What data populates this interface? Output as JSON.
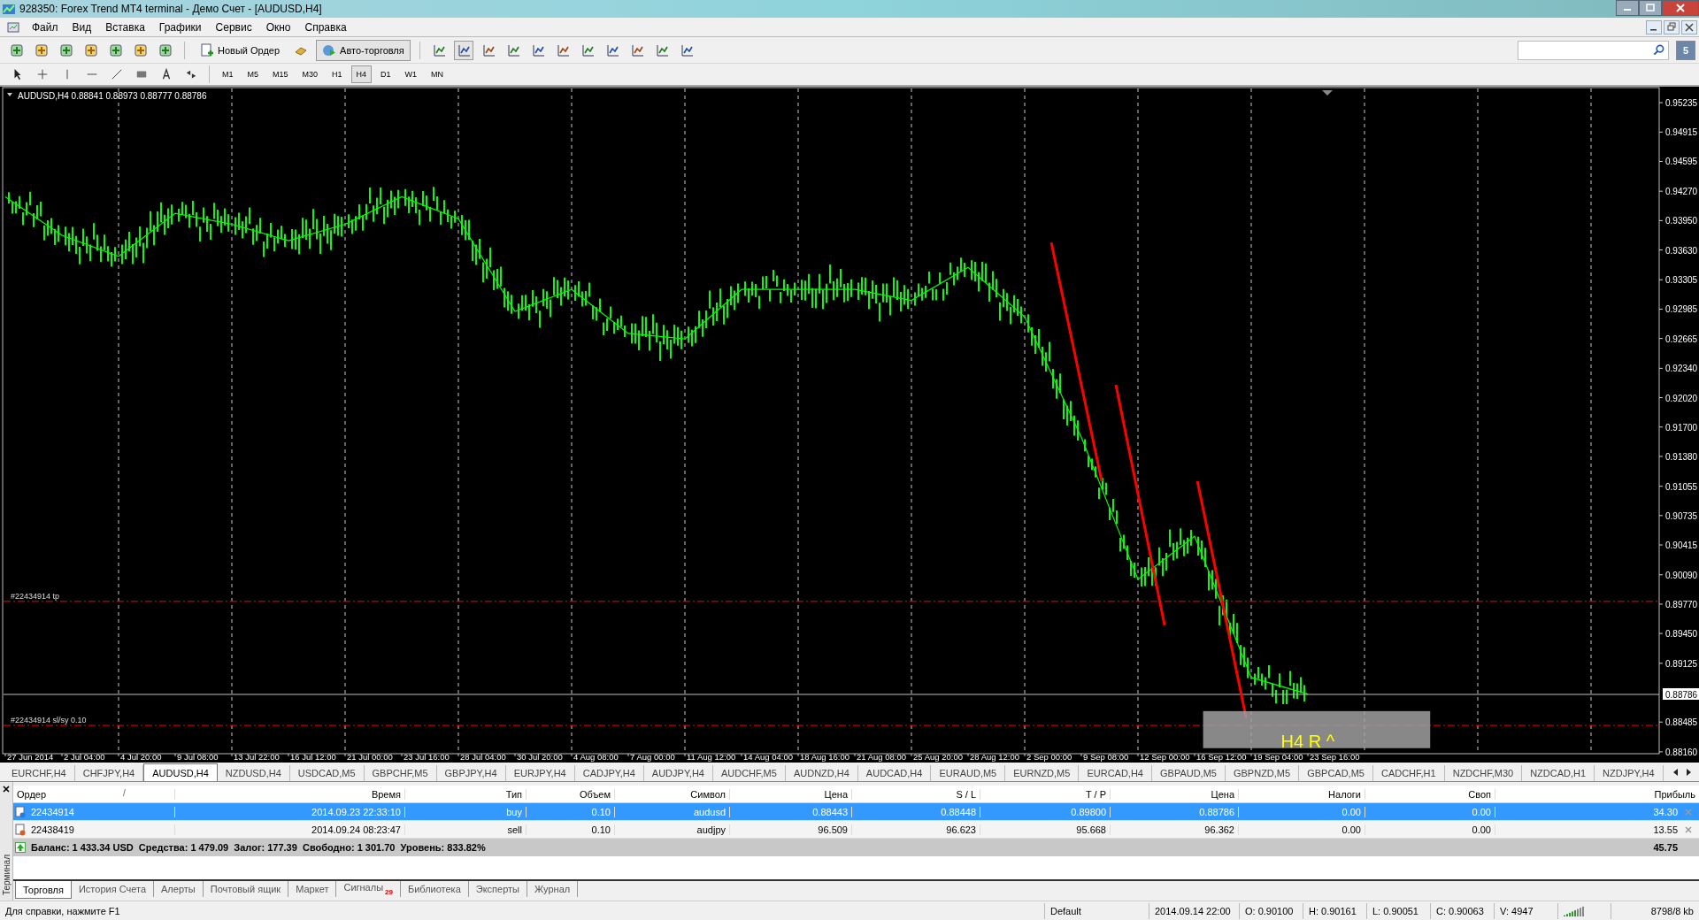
{
  "window": {
    "title": "928350: Forex Trend MT4 terminal - Демо Счет - [AUDUSD,H4]"
  },
  "menu": [
    "Файл",
    "Вид",
    "Вставка",
    "Графики",
    "Сервис",
    "Окно",
    "Справка"
  ],
  "toolbar": {
    "new_order": "Новый Ордер",
    "auto_trading": {
      "label": "Авто-торговля",
      "on": true
    },
    "notifications": "5"
  },
  "timeframes": [
    {
      "label": "M1",
      "selected": false
    },
    {
      "label": "M5",
      "selected": false
    },
    {
      "label": "M15",
      "selected": false
    },
    {
      "label": "M30",
      "selected": false
    },
    {
      "label": "H1",
      "selected": false
    },
    {
      "label": "H4",
      "selected": true
    },
    {
      "label": "D1",
      "selected": false
    },
    {
      "label": "W1",
      "selected": false
    },
    {
      "label": "MN",
      "selected": false
    }
  ],
  "chart": {
    "header": "AUDUSD,H4  0.88841 0.88973 0.88777 0.88786",
    "current_price": "0.88786",
    "time_axis": [
      "27 Jun 2014",
      "2 Jul 04:00",
      "4 Jul 20:00",
      "9 Jul 08:00",
      "13 Jul 22:00",
      "16 Jul 12:00",
      "21 Jul 00:00",
      "23 Jul 16:00",
      "28 Jul 04:00",
      "30 Jul 20:00",
      "4 Aug 08:00",
      "7 Aug 00:00",
      "11 Aug 12:00",
      "14 Aug 04:00",
      "18 Aug 16:00",
      "21 Aug 08:00",
      "25 Aug 20:00",
      "28 Aug 12:00",
      "2 Sep 00:00",
      "9 Sep 08:00",
      "12 Sep 00:00",
      "16 Sep 12:00",
      "19 Sep 04:00",
      "23 Sep 16:00"
    ],
    "price_axis": [
      "0.95235",
      "0.94915",
      "0.94595",
      "0.94270",
      "0.93950",
      "0.93630",
      "0.93305",
      "0.92985",
      "0.92665",
      "0.92340",
      "0.92020",
      "0.91700",
      "0.91380",
      "0.91055",
      "0.90735",
      "0.90415",
      "0.90090",
      "0.89770",
      "0.89450",
      "0.89125",
      "0.88485",
      "0.88160"
    ],
    "order_lines": [
      {
        "label": "#22434914 tp"
      },
      {
        "label": "#22434914 sl/sy 0.10"
      }
    ],
    "objects": [
      {
        "kind": "trendline"
      },
      {
        "kind": "trendline"
      },
      {
        "kind": "trendline"
      },
      {
        "kind": "box",
        "label": "H4 R ^"
      }
    ]
  },
  "chart_tabs": [
    {
      "label": "EURCHF,H4",
      "selected": false
    },
    {
      "label": "CHFJPY,H4",
      "selected": false
    },
    {
      "label": "AUDUSD,H4",
      "selected": true
    },
    {
      "label": "NZDUSD,H4",
      "selected": false
    },
    {
      "label": "USDCAD,M5",
      "selected": false
    },
    {
      "label": "GBPCHF,M5",
      "selected": false
    },
    {
      "label": "GBPJPY,H4",
      "selected": false
    },
    {
      "label": "EURJPY,H4",
      "selected": false
    },
    {
      "label": "CADJPY,H4",
      "selected": false
    },
    {
      "label": "AUDJPY,H4",
      "selected": false
    },
    {
      "label": "AUDCHF,M5",
      "selected": false
    },
    {
      "label": "AUDNZD,H4",
      "selected": false
    },
    {
      "label": "AUDCAD,H4",
      "selected": false
    },
    {
      "label": "EURAUD,M5",
      "selected": false
    },
    {
      "label": "EURNZD,M5",
      "selected": false
    },
    {
      "label": "EURCAD,H4",
      "selected": false
    },
    {
      "label": "GBPAUD,M5",
      "selected": false
    },
    {
      "label": "GBPNZD,M5",
      "selected": false
    },
    {
      "label": "GBPCAD,M5",
      "selected": false
    },
    {
      "label": "CADCHF,H1",
      "selected": false
    },
    {
      "label": "NZDCHF,M30",
      "selected": false
    },
    {
      "label": "NZDCAD,H1",
      "selected": false
    },
    {
      "label": "NZDJPY,H4",
      "selected": false
    }
  ],
  "terminal": {
    "side_label": "Терминал",
    "sort_indicator": "/",
    "columns": [
      "Ордер",
      "Время",
      "Тип",
      "Объем",
      "Символ",
      "Цена",
      "S / L",
      "T / P",
      "Цена",
      "Налоги",
      "Своп",
      "Прибыль"
    ],
    "rows": [
      {
        "kind": "buy",
        "selected": true,
        "cells": [
          "22434914",
          "2014.09.23 22:33:10",
          "buy",
          "0.10",
          "audusd",
          "0.88443",
          "0.88448",
          "0.89800",
          "0.88786",
          "0.00",
          "0.00",
          "34.30"
        ]
      },
      {
        "kind": "sell",
        "selected": false,
        "cells": [
          "22438419",
          "2014.09.24 08:23:47",
          "sell",
          "0.10",
          "audjpy",
          "96.509",
          "96.623",
          "95.668",
          "96.362",
          "0.00",
          "0.00",
          "13.55"
        ]
      }
    ],
    "summary": "Баланс: 1 433.34 USD  Средства: 1 479.09  Залог: 177.39  Свободно: 1 301.70  Уровень: 833.82%",
    "total": "45.75",
    "tabs": [
      {
        "label": "Торговля",
        "selected": true
      },
      {
        "label": "История Счета",
        "selected": false
      },
      {
        "label": "Алерты",
        "selected": false
      },
      {
        "label": "Почтовый ящик",
        "selected": false
      },
      {
        "label": "Маркет",
        "selected": false
      },
      {
        "label": "Сигналы",
        "badge": "29",
        "selected": false
      },
      {
        "label": "Библиотека",
        "selected": false
      },
      {
        "label": "Эксперты",
        "selected": false
      },
      {
        "label": "Журнал",
        "selected": false
      }
    ]
  },
  "status_bar": {
    "help": "Для справки, нажмите F1",
    "profile": "Default",
    "time": "2014.09.14 22:00",
    "open": "O: 0.90100",
    "high": "H: 0.90161",
    "low": "L: 0.90051",
    "close": "C: 0.90063",
    "volume": "V: 4947",
    "traffic": "8798/8 kb"
  }
}
